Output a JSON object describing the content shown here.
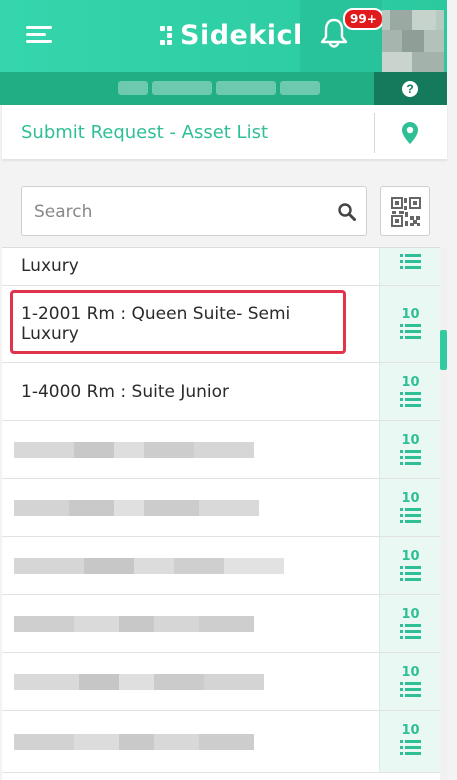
{
  "header": {
    "app_name": "Sidekick",
    "notification_badge": "99+",
    "accent_color": "#2fcfa7",
    "icons": [
      "menu-icon",
      "bell-icon",
      "help-icon"
    ]
  },
  "titlebar": {
    "title": "Submit Request - Asset List",
    "location_icon": "location-pin-icon"
  },
  "search": {
    "placeholder": "Search",
    "value": ""
  },
  "list": {
    "rows": [
      {
        "label": "Luxury",
        "count": ""
      },
      {
        "label_line1": "1-2001 Rm : Queen Suite- Semi",
        "label_line2": "Luxury",
        "count": "10"
      },
      {
        "label": "1-4000 Rm : Suite Junior",
        "count": "10"
      },
      {
        "label": "",
        "count": "10"
      },
      {
        "label": "",
        "count": "10"
      },
      {
        "label": "",
        "count": "10"
      },
      {
        "label": "",
        "count": "10"
      },
      {
        "label": "",
        "count": "10"
      },
      {
        "label": "",
        "count": "10"
      }
    ]
  }
}
